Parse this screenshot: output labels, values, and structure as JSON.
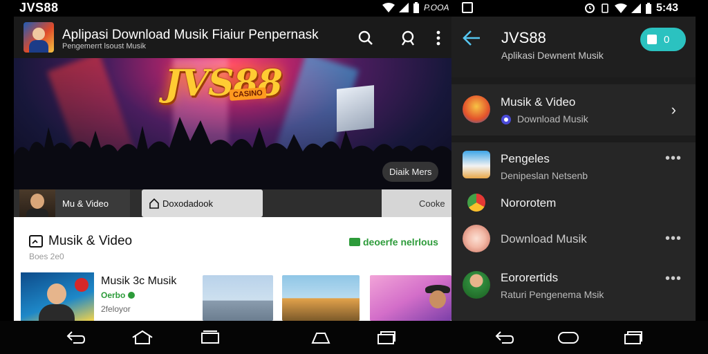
{
  "status": {
    "left_title": "JVS88",
    "left_icons": [
      "wifi-icon",
      "signal-icon",
      "battery-icon"
    ],
    "left_text": "P.OOA",
    "right_icons": [
      "alarm-icon",
      "vibrate-icon",
      "wifi-icon",
      "signal-icon",
      "battery-icon"
    ],
    "right_time": "5:43"
  },
  "left_app": {
    "header": {
      "title": "Aplipasi Download Musik Fiaiur Penpernask",
      "subtitle": "Pengemerrt lsoust Musik"
    },
    "hero": {
      "logo": "JVS88",
      "logo_sub": "CASINO",
      "pill": "Diaik Mers"
    },
    "strip": {
      "tile1": "Mu & Video",
      "tile2": "Doxodadook",
      "tile3": "Cooke"
    },
    "section": {
      "title": "Musik & Video",
      "subtitle": "Boes 2e0",
      "link": "deoerfe nelrlous"
    },
    "card": {
      "title": "Musik 3c Musik",
      "tag": "Oerbo",
      "meta": "2feloyor"
    }
  },
  "right_panel": {
    "header": {
      "title": "JVS88",
      "subtitle": "Aplikasi Dewnent Musik",
      "toggle_value": "0"
    },
    "rows": [
      {
        "title": "Musik & Video",
        "subtitle": "Download Musik"
      },
      {
        "title": "Pengeles",
        "subtitle": "Denipeslan Netsenb"
      },
      {
        "title": "Nororotem",
        "subtitle": ""
      },
      {
        "title": "Download Musik",
        "subtitle": ""
      },
      {
        "title": "Eororertids",
        "subtitle": "Raturi Pengenema Msik"
      }
    ]
  },
  "colors": {
    "accent_teal": "#2bc2c0",
    "accent_green": "#2d9b3a",
    "panel_bg": "#262626",
    "header_bg": "#1a1a1a"
  }
}
